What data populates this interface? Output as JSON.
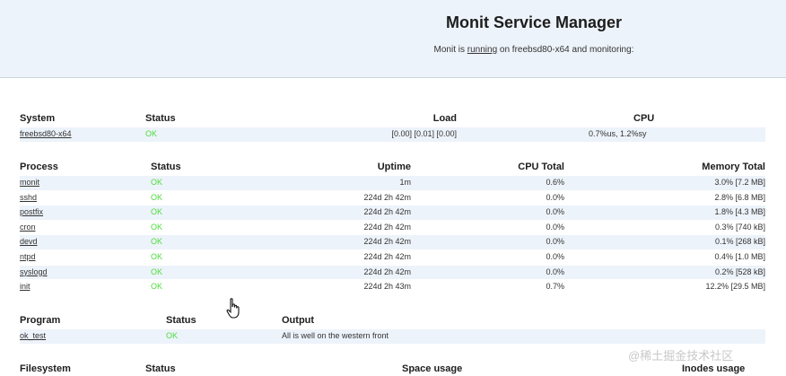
{
  "header": {
    "title": "Monit Service Manager",
    "subtitle_pre": "Monit is ",
    "subtitle_link": "running",
    "subtitle_post": " on freebsd80-x64 and monitoring:"
  },
  "system": {
    "headers": [
      "System",
      "Status",
      "Load",
      "CPU"
    ],
    "rows": [
      {
        "name": "freebsd80-x64",
        "status": "OK",
        "load": "[0.00] [0.01] [0.00]",
        "cpu": "0.7%us, 1.2%sy"
      }
    ]
  },
  "process": {
    "headers": [
      "Process",
      "Status",
      "Uptime",
      "CPU Total",
      "Memory Total"
    ],
    "rows": [
      {
        "name": "monit",
        "status": "OK",
        "uptime": "1m",
        "cpu": "0.6%",
        "memory": "3.0% [7.2 MB]"
      },
      {
        "name": "sshd",
        "status": "OK",
        "uptime": "224d 2h 42m",
        "cpu": "0.0%",
        "memory": "2.8% [6.8 MB]"
      },
      {
        "name": "postfix",
        "status": "OK",
        "uptime": "224d 2h 42m",
        "cpu": "0.0%",
        "memory": "1.8% [4.3 MB]"
      },
      {
        "name": "cron",
        "status": "OK",
        "uptime": "224d 2h 42m",
        "cpu": "0.0%",
        "memory": "0.3% [740 kB]"
      },
      {
        "name": "devd",
        "status": "OK",
        "uptime": "224d 2h 42m",
        "cpu": "0.0%",
        "memory": "0.1% [268 kB]"
      },
      {
        "name": "ntpd",
        "status": "OK",
        "uptime": "224d 2h 42m",
        "cpu": "0.0%",
        "memory": "0.4% [1.0 MB]"
      },
      {
        "name": "syslogd",
        "status": "OK",
        "uptime": "224d 2h 42m",
        "cpu": "0.0%",
        "memory": "0.2% [528 kB]"
      },
      {
        "name": "init",
        "status": "OK",
        "uptime": "224d 2h 43m",
        "cpu": "0.7%",
        "memory": "12.2% [29.5 MB]"
      }
    ]
  },
  "program": {
    "headers": [
      "Program",
      "Status",
      "Output"
    ],
    "rows": [
      {
        "name": "ok_test",
        "status": "OK",
        "output": "All is well on the western front"
      }
    ]
  },
  "filesystem": {
    "headers": [
      "Filesystem",
      "Status",
      "Space usage",
      "Inodes usage"
    ]
  },
  "watermark": "@稀土掘金技术社区",
  "colors": {
    "ok": "#4ddc3c",
    "header_bg": "#edf3fa",
    "row_shade": "#edf3fa"
  },
  "cursor_icon": "hand-pointer-icon"
}
